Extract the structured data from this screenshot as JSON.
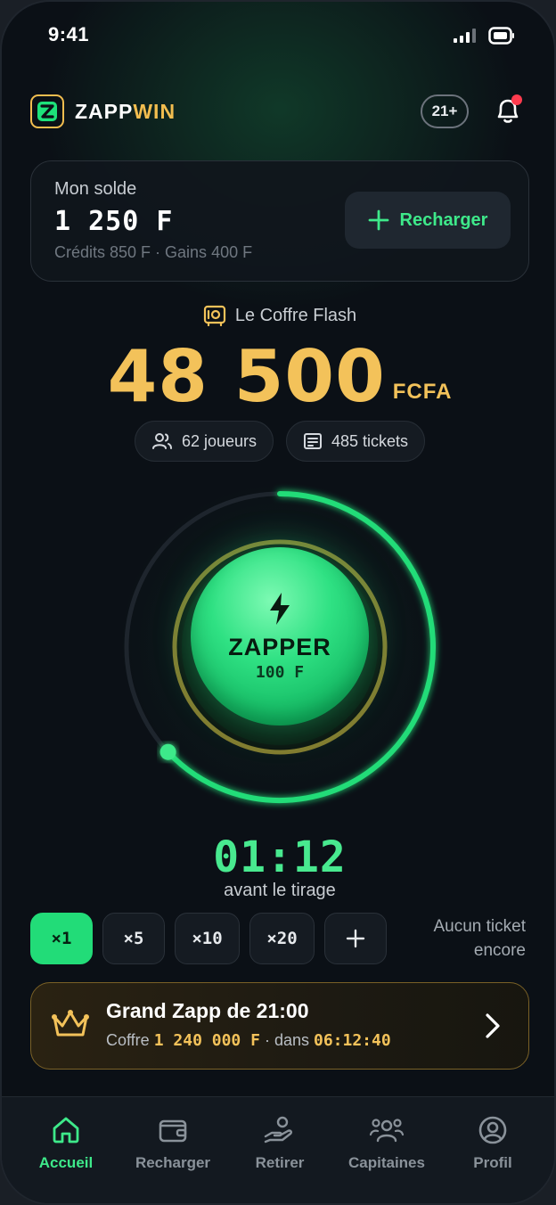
{
  "status_bar": {
    "time": "9:41"
  },
  "header": {
    "logo_part1": "ZAPP",
    "logo_part2": "WIN",
    "logo_letter": "Z",
    "age_badge": "21+",
    "notification_icon": "bell-icon"
  },
  "balance": {
    "label": "Mon solde",
    "amount": "1 250 F",
    "details": "Crédits 850 F · Gains 400 F",
    "recharge_label": "Recharger"
  },
  "vault": {
    "title": "Le Coffre Flash",
    "amount": "48 500",
    "currency": "FCFA",
    "players": "62 joueurs",
    "tickets": "485 tickets"
  },
  "zap_button": {
    "label": "ZAPPER",
    "price": "100 F",
    "progress": 0.63
  },
  "timer": {
    "value": "01:12",
    "caption": "avant le tirage"
  },
  "multipliers": {
    "options": [
      "×1",
      "×5",
      "×10",
      "×20"
    ],
    "selected": "×1",
    "add_label": "+",
    "empty_line1": "Aucun ticket",
    "empty_line2": "encore"
  },
  "grand_zapp": {
    "title": "Grand Zapp de 21:00",
    "prefix": "Coffre",
    "amount": "1 240 000 F",
    "middle": "· dans",
    "countdown": "06:12:40"
  },
  "tabs": [
    {
      "label": "Accueil",
      "icon": "home-icon",
      "active": true
    },
    {
      "label": "Recharger",
      "icon": "wallet-icon",
      "active": false
    },
    {
      "label": "Retirer",
      "icon": "withdraw-icon",
      "active": false
    },
    {
      "label": "Capitaines",
      "icon": "users-icon",
      "active": false
    },
    {
      "label": "Profil",
      "icon": "profile-icon",
      "active": false
    }
  ],
  "colors": {
    "accent_green": "#22dc78",
    "gold": "#f3c25a",
    "background": "#0b1016",
    "alert_red": "#ff3b4e"
  }
}
